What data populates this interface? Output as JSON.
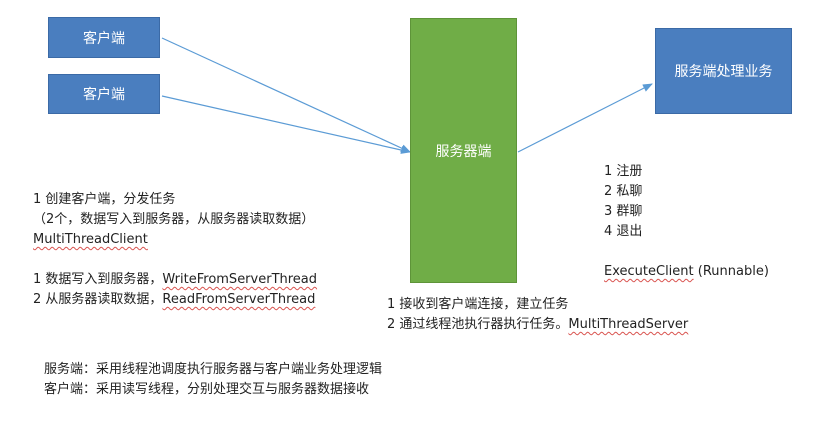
{
  "boxes": {
    "client1": "客户端",
    "client2": "客户端",
    "server": "服务器端",
    "business": "服务端处理业务"
  },
  "client_notes": {
    "line1": "1 创建客户端，分发任务",
    "line2": "（2个，数据写入到服务器，从服务器读取数据）",
    "line3": "MultiThreadClient",
    "line4_prefix": "1 数据写入到服务器，",
    "line4_class": "WriteFromServerThread",
    "line5_prefix": "2 从服务器读取数据，",
    "line5_class": "ReadFromServerThread"
  },
  "server_notes": {
    "line1": "1 接收到客户端连接，建立任务",
    "line2_prefix": "2 通过线程池执行器执行任务。",
    "line2_class": "MultiThreadServer"
  },
  "business_notes": {
    "items": [
      "1 注册",
      "2 私聊",
      "3 群聊",
      "4 退出"
    ],
    "class_name": "ExecuteClient",
    "class_suffix": "(Runnable)"
  },
  "summary": {
    "line1": "服务端：采用线程池调度执行服务器与客户端业务处理逻辑",
    "line2": "客户端：采用读写线程，分别处理交互与服务器数据接收"
  },
  "colors": {
    "client_box": "#4a7ebf",
    "server_box": "#70ad47",
    "arrow": "#5b9bd5"
  }
}
